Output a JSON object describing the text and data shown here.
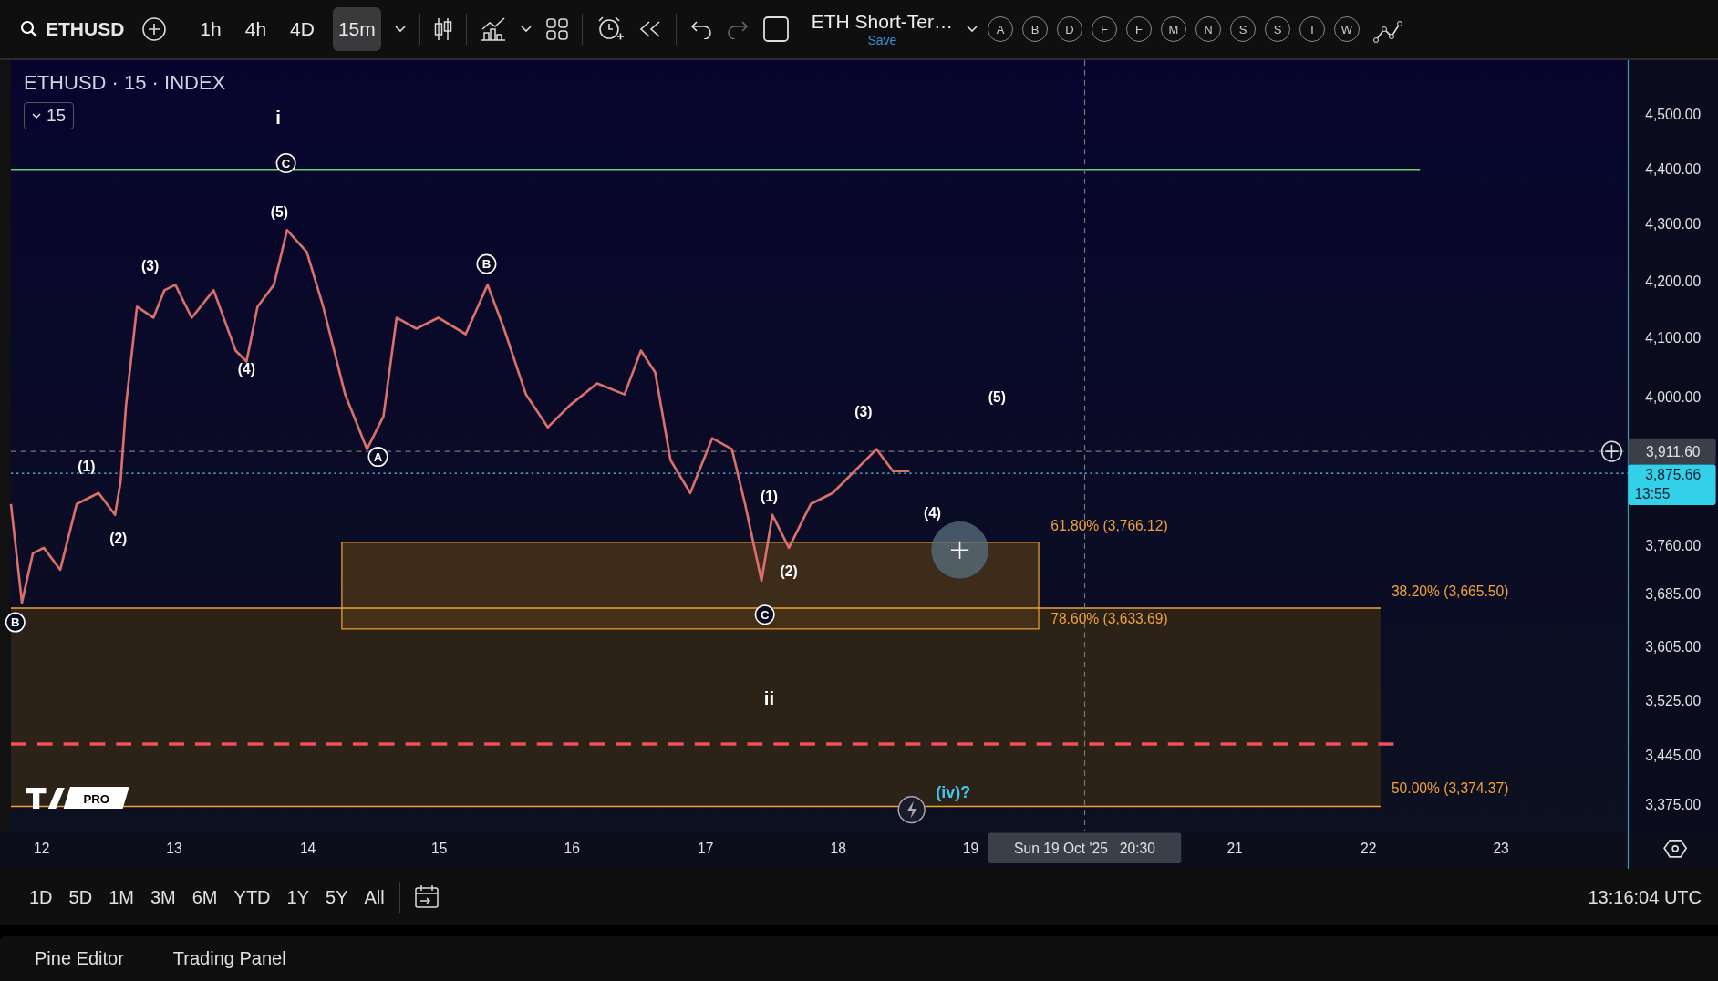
{
  "toolbar": {
    "symbol": "ETHUSD",
    "intervals": [
      {
        "label": "1h",
        "selected": false
      },
      {
        "label": "4h",
        "selected": false
      },
      {
        "label": "4D",
        "selected": false
      },
      {
        "label": "15m",
        "selected": true
      }
    ],
    "layout_name": "ETH Short-Ter…",
    "save_label": "Save",
    "letter_buttons": [
      "A",
      "B",
      "D",
      "F",
      "F",
      "M",
      "N",
      "S",
      "S",
      "T",
      "W"
    ]
  },
  "chart": {
    "legend": "ETHUSD · 15 · INDEX",
    "interval_badge": "15",
    "wave_labels": [
      {
        "kind": "roman",
        "text": "i"
      },
      {
        "kind": "circled",
        "text": "C"
      },
      {
        "kind": "paren",
        "text": "(5)"
      },
      {
        "kind": "paren",
        "text": "(3)"
      },
      {
        "kind": "circled",
        "text": "B"
      },
      {
        "kind": "paren",
        "text": "(4)"
      },
      {
        "kind": "paren",
        "text": "(5)"
      },
      {
        "kind": "paren",
        "text": "(3)"
      },
      {
        "kind": "circled",
        "text": "A"
      },
      {
        "kind": "paren",
        "text": "(1)"
      },
      {
        "kind": "paren",
        "text": "(1)"
      },
      {
        "kind": "paren",
        "text": "(4)"
      },
      {
        "kind": "paren",
        "text": "(2)"
      },
      {
        "kind": "paren",
        "text": "(2)"
      },
      {
        "kind": "circled",
        "text": "C"
      },
      {
        "kind": "circled",
        "text": "B"
      },
      {
        "kind": "roman",
        "text": "ii"
      },
      {
        "kind": "alt",
        "text": "(iv)?"
      }
    ],
    "fib_levels": [
      {
        "label": "61.80% (3,766.12)"
      },
      {
        "label": "78.60% (3,633.69)"
      },
      {
        "label": "38.20% (3,665.50)"
      },
      {
        "label": "50.00% (3,374.37)"
      }
    ],
    "price_axis": [
      "4,500.00",
      "4,400.00",
      "4,300.00",
      "4,200.00",
      "4,100.00",
      "4,000.00",
      "3,760.00",
      "3,685.00",
      "3,605.00",
      "3,525.00",
      "3,445.00",
      "3,375.00"
    ],
    "crosshair_price": "3,911.60",
    "last_price": "3,875.66",
    "countdown": "13:55",
    "time_axis": [
      "12",
      "13",
      "14",
      "15",
      "16",
      "17",
      "18",
      "19",
      "21",
      "22",
      "23"
    ],
    "crosshair_time": "Sun 19 Oct '25   20:30",
    "logo_badge": "PRO"
  },
  "range_bar": {
    "ranges": [
      "1D",
      "5D",
      "1M",
      "3M",
      "6M",
      "YTD",
      "1Y",
      "5Y",
      "All"
    ],
    "clock": "13:16:04 UTC"
  },
  "bottom_tabs": [
    "Pine Editor",
    "Trading Panel"
  ]
}
